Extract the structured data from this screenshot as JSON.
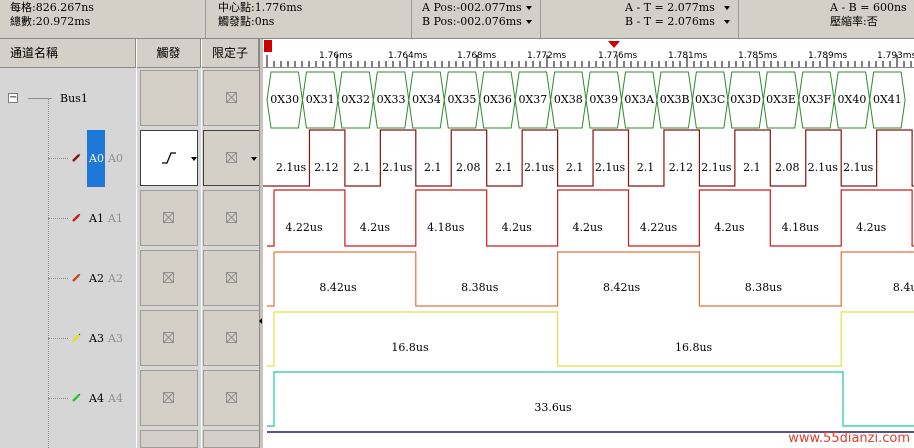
{
  "info": {
    "sample_rate": "每格:826.267ns",
    "total": "總數:20.972ms",
    "center": "中心點:1.776ms",
    "trigger_point": "觸發點:0ns",
    "a_pos": "A Pos:-002.077ms",
    "b_pos": "B Pos:-002.076ms",
    "a_t": "A - T = 2.077ms",
    "b_t": "B - T = 2.076ms",
    "a_b": "A - B = 600ns",
    "compress": "壓縮率:否"
  },
  "headers": {
    "channel": "通道名稱",
    "trigger": "觸發",
    "qualifier": "限定子"
  },
  "bus": {
    "label": "Bus1",
    "expand": "−"
  },
  "channels": [
    {
      "name": "A0",
      "alias": "A0",
      "color": "#8b1010"
    },
    {
      "name": "A1",
      "alias": "A1",
      "color": "#cc1a1a"
    },
    {
      "name": "A2",
      "alias": "A2",
      "color": "#c0501c"
    },
    {
      "name": "A3",
      "alias": "A3",
      "color": "#e8e020"
    },
    {
      "name": "A4",
      "alias": "A4",
      "color": "#1ccc2c"
    }
  ],
  "ruler_ticks": [
    "1.76ms",
    "1.764ms",
    "1.768ms",
    "1.772ms",
    "1.776ms",
    "1.781ms",
    "1.785ms",
    "1.789ms",
    "1.793ms"
  ],
  "bus_values": [
    "0X30",
    "0X31",
    "0X32",
    "0X33",
    "0X34",
    "0X35",
    "0X36",
    "0X37",
    "0X38",
    "0X39",
    "0X3A",
    "0X3B",
    "0X3C",
    "0X3D",
    "0X3E",
    "0X3F",
    "0X40",
    "0X41"
  ],
  "a0_labels": [
    "2.1us",
    "2.12",
    "2.1",
    "2.1us",
    "2.1",
    "2.08",
    "2.1",
    "2.1us",
    "2.1",
    "2.1us",
    "2.1",
    "2.12",
    "2.1us",
    "2.1",
    "2.08",
    "2.1us",
    "2.1us"
  ],
  "a1_labels": [
    "4.22us",
    "4.2us",
    "4.18us",
    "4.2us",
    "4.2us",
    "4.22us",
    "4.2us",
    "4.18us",
    "4.2us"
  ],
  "a2_labels": [
    "8.42us",
    "8.38us",
    "8.42us",
    "8.38us",
    "8.4u"
  ],
  "a3_labels": [
    "16.8us",
    "16.8us"
  ],
  "a4_labels": [
    "33.6us"
  ],
  "watermark": "www.55dianzi.com",
  "colors": {
    "bus": "#2e8b2e",
    "a0": "#8b1010",
    "a1": "#cc1a1a",
    "a2": "#e07040",
    "a3": "#e8e040",
    "a4": "#20c8a0",
    "cursor": "#cc0000"
  }
}
